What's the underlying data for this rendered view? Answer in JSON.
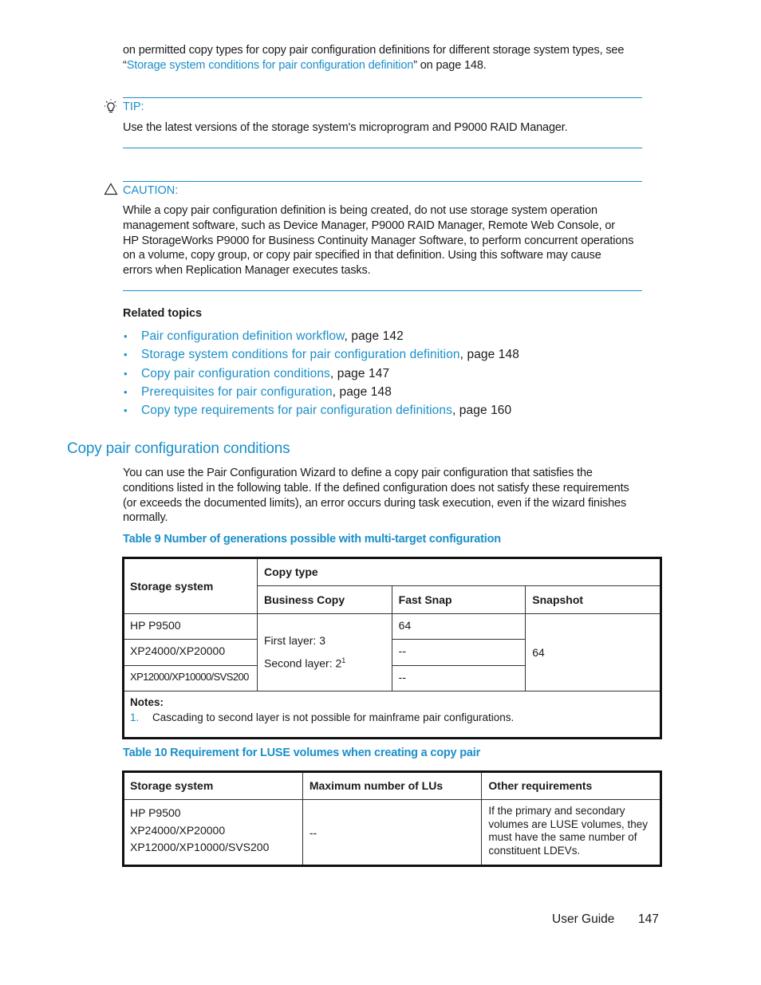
{
  "intro": {
    "line1": "on permitted copy types for copy pair configuration definitions for different storage system types, see",
    "open_quote": "“",
    "link_text": "Storage system conditions for pair configuration definition",
    "close_quote": "”",
    "suffix": " on page 148."
  },
  "tip": {
    "icon": "lightbulb-icon",
    "label": "TIP:",
    "text": "Use the latest versions of the storage system's microprogram and P9000 RAID Manager."
  },
  "caution": {
    "icon": "warning-triangle-icon",
    "label": "CAUTION:",
    "lines": [
      "While a copy pair configuration definition is being created, do not use storage system operation",
      "management software, such as Device Manager, P9000 RAID Manager, Remote Web Console, or",
      "HP StorageWorks P9000 for Business Continuity Manager Software, to perform concurrent operations",
      "on a volume, copy group, or copy pair specified in that definition. Using this software may cause",
      "errors when Replication Manager executes tasks."
    ]
  },
  "related": {
    "title": "Related topics",
    "bullet": "•",
    "items": [
      {
        "link": "Pair configuration definition workflow",
        "page": ", page 142"
      },
      {
        "link": "Storage system conditions for pair configuration definition",
        "page": ", page 148"
      },
      {
        "link": "Copy pair configuration conditions",
        "page": ", page 147"
      },
      {
        "link": "Prerequisites for pair configuration",
        "page": ", page 148"
      },
      {
        "link": "Copy type requirements for pair configuration definitions",
        "page": ", page 160"
      }
    ]
  },
  "section": {
    "heading": "Copy pair configuration conditions",
    "lines": [
      "You can use the Pair Configuration Wizard to define a copy pair configuration that satisfies the",
      "conditions listed in the following table. If the defined configuration does not satisfy these requirements",
      "(or exceeds the documented limits), an error occurs during task execution, even if the wizard finishes",
      "normally."
    ]
  },
  "table9": {
    "caption": "Table 9 Number of generations possible with multi-target configuration",
    "headers": {
      "storage_system": "Storage system",
      "copy_type": "Copy type",
      "business_copy": "Business Copy",
      "fast_snap": "Fast Snap",
      "snapshot": "Snapshot"
    },
    "rows": [
      {
        "system": "HP P9500",
        "fast_snap": "64"
      },
      {
        "system": "XP24000/XP20000",
        "fast_snap": "--"
      },
      {
        "system": "XP12000/XP10000/SVS200",
        "fast_snap": "--"
      }
    ],
    "business_copy_merged": {
      "line1": "First layer: 3",
      "line2": "Second layer: 2",
      "sup": "1"
    },
    "snapshot_merged": "64",
    "notes_title": "Notes:",
    "notes": [
      {
        "num": "1.",
        "text": "Cascading to second layer is not possible for mainframe pair configurations."
      }
    ]
  },
  "table10": {
    "caption": "Table 10 Requirement for LUSE volumes when creating a copy pair",
    "headers": [
      "Storage system",
      "Maximum number of LUs",
      "Other requirements"
    ],
    "row": {
      "systems": [
        "HP P9500",
        "XP24000/XP20000",
        "XP12000/XP10000/SVS200"
      ],
      "max_lus": "--",
      "other": [
        "If the primary and secondary",
        "volumes are LUSE volumes, they",
        "must have the same number of",
        "constituent LDEVs."
      ]
    }
  },
  "footer": {
    "title": "User Guide",
    "page": "147"
  }
}
